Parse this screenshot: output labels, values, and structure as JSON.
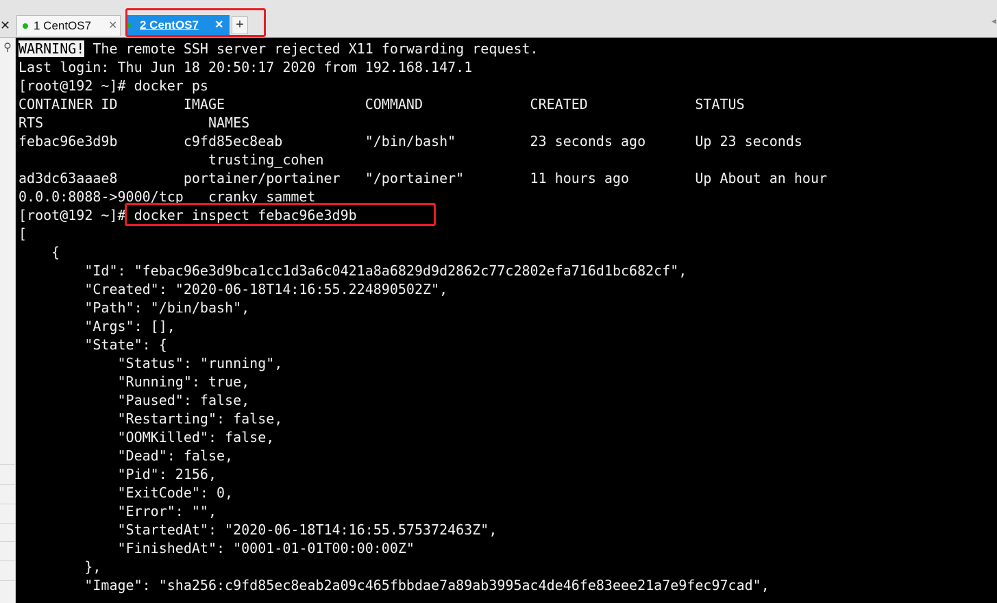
{
  "window": {
    "close_glyph": "✕"
  },
  "tabs": [
    {
      "label": "1 CentOS7",
      "status": "connected",
      "close_glyph": "✕",
      "active": false
    },
    {
      "label": "2 CentOS7",
      "status": "connected",
      "close_glyph": "✕",
      "active": true
    }
  ],
  "new_tab_label": "+",
  "colors": {
    "terminal_bg": "#000000",
    "terminal_fg": "#f2f2f2",
    "active_tab": "#1b8fe8",
    "status_dot": "#18b818",
    "annotation_red": "#ea1c24"
  },
  "terminal": {
    "warning_badge": "WARNING!",
    "warning_text": " The remote SSH server rejected X11 forwarding request.",
    "lines": [
      "Last login: Thu Jun 18 20:50:17 2020 from 192.168.147.1",
      "[root@192 ~]# docker ps",
      "CONTAINER ID        IMAGE                 COMMAND             CREATED             STATUS",
      "RTS                    NAMES",
      "febac96e3d9b        c9fd85ec8eab          \"/bin/bash\"         23 seconds ago      Up 23 seconds",
      "                       trusting_cohen",
      "ad3dc63aaae8        portainer/portainer   \"/portainer\"        11 hours ago        Up About an hour",
      "0.0.0:8088->9000/tcp   cranky_sammet",
      "[root@192 ~]# docker inspect febac96e3d9b",
      "[",
      "    {",
      "        \"Id\": \"febac96e3d9bca1cc1d3a6c0421a8a6829d9d2862c77c2802efa716d1bc682cf\",",
      "        \"Created\": \"2020-06-18T14:16:55.224890502Z\",",
      "        \"Path\": \"/bin/bash\",",
      "        \"Args\": [],",
      "        \"State\": {",
      "            \"Status\": \"running\",",
      "            \"Running\": true,",
      "            \"Paused\": false,",
      "            \"Restarting\": false,",
      "            \"OOMKilled\": false,",
      "            \"Dead\": false,",
      "            \"Pid\": 2156,",
      "            \"ExitCode\": 0,",
      "            \"Error\": \"\",",
      "            \"StartedAt\": \"2020-06-18T14:16:55.575372463Z\",",
      "            \"FinishedAt\": \"0001-01-01T00:00:00Z\"",
      "        },",
      "        \"Image\": \"sha256:c9fd85ec8eab2a09c465fbbdae7a89ab3995ac4de46fe83eee21a7e9fec97cad\","
    ]
  }
}
